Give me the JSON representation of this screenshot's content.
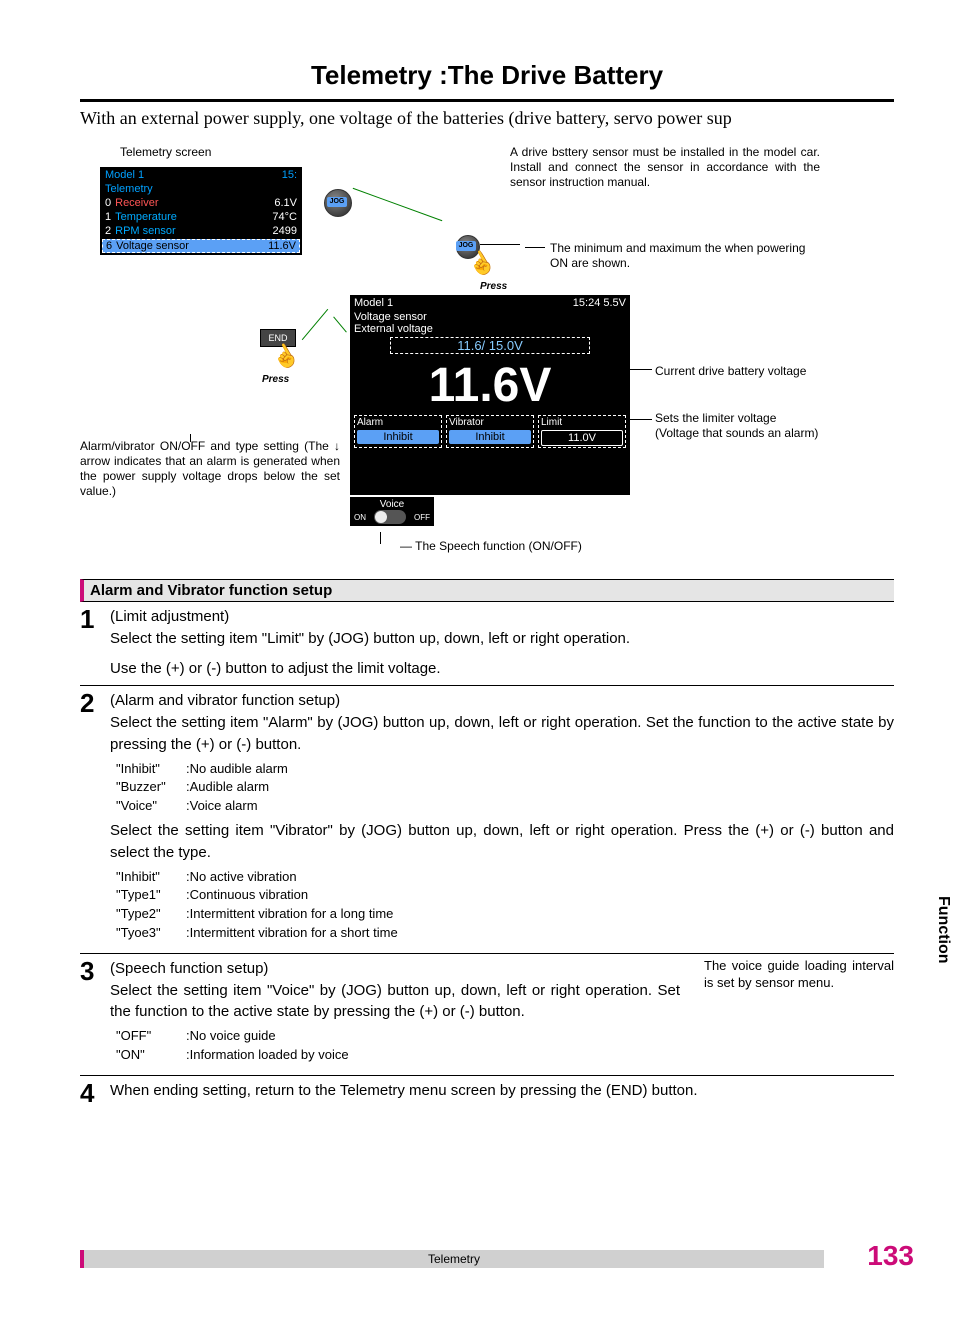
{
  "title": "Telemetry :The Drive Battery",
  "intro": "With an external power supply, one voltage of the batteries (drive battery, servo power sup",
  "sideTab": "Function",
  "figure": {
    "telemetry_screen_label": "Telemetry screen",
    "small_screen": {
      "header_left": "Model 1",
      "header_right": "15:",
      "title": "Telemetry",
      "row0l": "Receiver",
      "row0r": "6.1V",
      "row1l": "Temperature",
      "row1r": "74°C",
      "row2l": "RPM sensor",
      "row2r": "2499",
      "row3l": "Voltage sensor",
      "row3r": "11.6V",
      "idx0": "0",
      "idx1": "1",
      "idx2": "2",
      "idx3": "6"
    },
    "jog_label": "JOG",
    "end_label": "END",
    "press_label": "Press",
    "big_screen": {
      "top_left": "Model 1",
      "top_right": "15:24 5.5V",
      "line2a": "Voltage sensor",
      "line2b": "External voltage",
      "sub_value": "11.6/ 15.0V",
      "main_value": "11.6V",
      "col_alarm": "Alarm",
      "col_vibrator": "Vibrator",
      "col_limit": "Limit",
      "val_alarm": "Inhibit",
      "val_vibrator": "Inhibit",
      "val_limit": "11.0V",
      "voice_label": "Voice",
      "voice_on": "ON",
      "voice_off": "OFF"
    },
    "annot_sensor": "A drive bsttery sensor must be installed in the model car.\nInstall and connect the sensor in accordance with the sensor instruction manual.",
    "annot_minmax": "The minimum and maximum the when powering ON are shown.",
    "annot_current": "Current drive battery voltage",
    "annot_limit1": "Sets the limiter voltage",
    "annot_limit2": "(Voltage that sounds an alarm)",
    "annot_alarm": "Alarm/vibrator ON/OFF and type setting (The ↓ arrow indicates that an alarm is generated when the power supply voltage drops below the set value.)",
    "annot_speech": "The Speech function (ON/OFF)"
  },
  "section_header": "Alarm and Vibrator function setup",
  "steps": [
    {
      "num": "1",
      "head": "(Limit adjustment)",
      "p1": "Select the setting item \"Limit\" by (JOG) button up, down, left or right operation.",
      "p2": "Use the (+) or (-) button to adjust the limit voltage."
    },
    {
      "num": "2",
      "head": "(Alarm and vibrator function setup)",
      "p1": "Select the setting item \"Alarm\" by (JOG) button up, down, left or right operation. Set the function to the active state by pressing the (+) or (-) button.",
      "list1": [
        {
          "k": "\"Inhibit\"",
          "v": ":No audible alarm"
        },
        {
          "k": "\"Buzzer\"",
          "v": ":Audible alarm"
        },
        {
          "k": "\"Voice\"",
          "v": ":Voice alarm"
        }
      ],
      "p2": "Select the setting item \"Vibrator\" by (JOG) button up, down, left or right operation. Press the (+) or (-) button and select the type.",
      "list2": [
        {
          "k": "\"Inhibit\"",
          "v": ":No active vibration"
        },
        {
          "k": "\"Type1\"",
          "v": ":Continuous vibration"
        },
        {
          "k": "\"Type2\"",
          "v": ":Intermittent vibration for a long time"
        },
        {
          "k": "\"Tyoe3\"",
          "v": ":Intermittent vibration for a short time"
        }
      ]
    },
    {
      "num": "3",
      "head": "(Speech function setup)",
      "p1": "Select the setting item \"Voice\" by (JOG) button up, down, left or right operation. Set the function to the active state by pressing the (+) or (-) button.",
      "side": "The voice guide loading interval is set by sensor menu.",
      "list1": [
        {
          "k": "\"OFF\"",
          "v": ":No voice guide"
        },
        {
          "k": "\"ON\"",
          "v": ":Information loaded by voice"
        }
      ]
    },
    {
      "num": "4",
      "p1": "When ending setting, return to the Telemetry menu screen by pressing the (END) button."
    }
  ],
  "footer_label": "Telemetry",
  "page_number": "133"
}
